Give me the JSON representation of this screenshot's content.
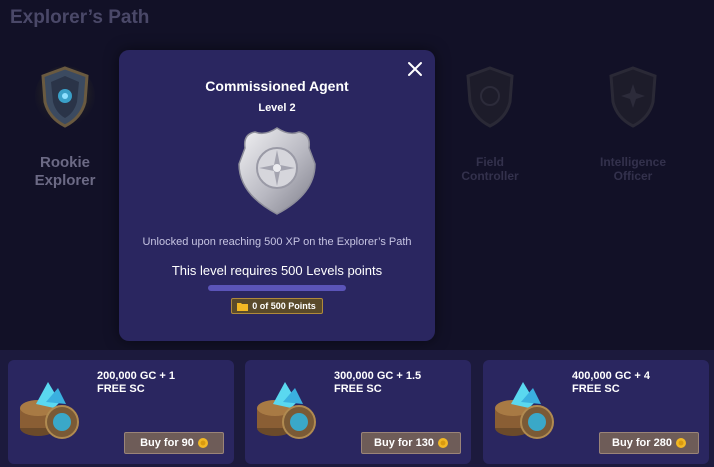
{
  "page": {
    "title": "Explorer’s Path"
  },
  "levels": [
    {
      "label_line1": "Rookie",
      "label_line2": "Explorer"
    },
    {
      "label_line1": "Field",
      "label_line2": "Controller"
    },
    {
      "label_line1": "Intelligence",
      "label_line2": "Officer"
    }
  ],
  "modal": {
    "title": "Commissioned Agent",
    "subtitle": "Level 2",
    "description": "Unlocked upon reaching 500 XP on the Explorer’s Path",
    "requirement": "This level requires 500 Levels points",
    "progress": 0,
    "points_text": "0 of 500 Points",
    "close_icon": "close-icon"
  },
  "offers": [
    {
      "line1": "200,000 GC + 1",
      "line2": "FREE SC",
      "buy_label": "Buy for 90"
    },
    {
      "line1": "300,000 GC + 1.5",
      "line2": "FREE SC",
      "buy_label": "Buy for 130"
    },
    {
      "line1": "400,000 GC + 4",
      "line2": "FREE SC",
      "buy_label": "Buy for 280"
    }
  ],
  "colors": {
    "background": "#121127",
    "modal": "#2a2660",
    "offer_card": "#2a2660",
    "buy_button": "#6e5c58",
    "gold_coin": "#f2b824"
  }
}
